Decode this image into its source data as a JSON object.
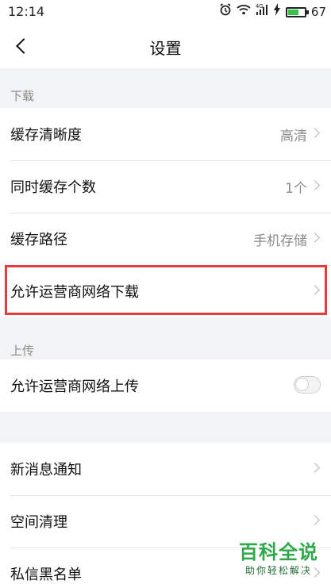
{
  "status_bar": {
    "time": "12:14",
    "battery_percent": "67",
    "battery_level": 0.67,
    "signal_label": "4G",
    "icons": [
      "alarm-icon",
      "wifi-icon",
      "signal-icon",
      "charging-icon",
      "battery-icon"
    ]
  },
  "header": {
    "title": "设置",
    "back_icon": "chevron-left-icon"
  },
  "sections": {
    "download": {
      "label": "下载",
      "rows": [
        {
          "label": "缓存清晰度",
          "value": "高清"
        },
        {
          "label": "同时缓存个数",
          "value": "1个"
        },
        {
          "label": "缓存路径",
          "value": "手机存储"
        },
        {
          "label": "允许运营商网络下载",
          "value": ""
        }
      ]
    },
    "upload": {
      "label": "上传",
      "rows": [
        {
          "label": "允许运营商网络上传",
          "toggle_on": false
        }
      ]
    },
    "other": {
      "rows": [
        {
          "label": "新消息通知"
        },
        {
          "label": "空间清理"
        },
        {
          "label": "私信黑名单"
        }
      ]
    }
  },
  "watermark": {
    "main": "百科全说",
    "sub": "助你轻松解决"
  },
  "colors": {
    "highlight": "#e53b3b",
    "page_bg": "#f2f3f5",
    "battery_fill": "#33c24a"
  }
}
